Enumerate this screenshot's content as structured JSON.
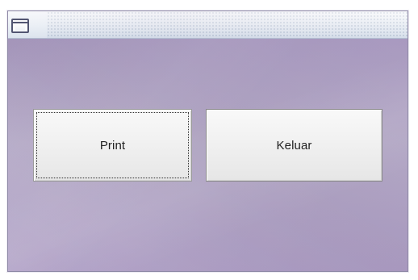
{
  "window": {
    "title": "",
    "icon": "window-icon",
    "background_color": "#b3a8c9"
  },
  "buttons": {
    "print_label": "Print",
    "keluar_label": "Keluar"
  },
  "colors": {
    "titlebar": "#dfe7f0",
    "button_face": "#f1f1f1",
    "button_border": "#8a8a8a",
    "focus_outline": "#2d2d2d",
    "text": "#222222"
  }
}
